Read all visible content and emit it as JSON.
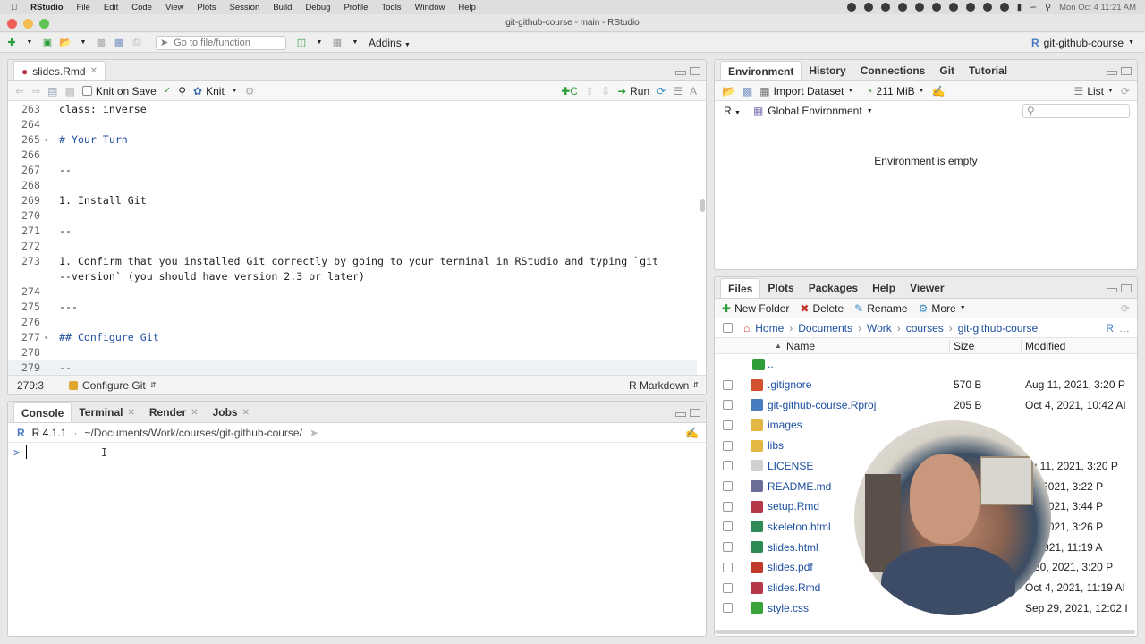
{
  "menubar": {
    "items": [
      "RStudio",
      "File",
      "Edit",
      "Code",
      "View",
      "Plots",
      "Session",
      "Build",
      "Debug",
      "Profile",
      "Tools",
      "Window",
      "Help"
    ],
    "clock": "Mon Oct 4  11:21 AM"
  },
  "window": {
    "title": "git-github-course - main - RStudio"
  },
  "toolbar": {
    "goto_placeholder": "Go to file/function",
    "addins_label": "Addins",
    "project_label": "git-github-course"
  },
  "editor": {
    "tab_label": "slides.Rmd",
    "knit_on_save_label": "Knit on Save",
    "knit_label": "Knit",
    "run_label": "Run",
    "lines": [
      {
        "n": "263",
        "text": "class: inverse",
        "fold": false
      },
      {
        "n": "264",
        "text": "",
        "fold": false
      },
      {
        "n": "265",
        "text": "# Your Turn",
        "fold": true
      },
      {
        "n": "266",
        "text": "",
        "fold": false
      },
      {
        "n": "267",
        "text": "--",
        "fold": false
      },
      {
        "n": "268",
        "text": "",
        "fold": false
      },
      {
        "n": "269",
        "text": "1. Install Git",
        "fold": false
      },
      {
        "n": "270",
        "text": "",
        "fold": false
      },
      {
        "n": "271",
        "text": "--",
        "fold": false
      },
      {
        "n": "272",
        "text": "",
        "fold": false
      },
      {
        "n": "273",
        "text": "1. Confirm that you installed Git correctly by going to your terminal in RStudio and typing `git",
        "cont": "--version` (you should have version 2.3 or later)",
        "fold": false
      },
      {
        "n": "274",
        "text": "",
        "fold": false
      },
      {
        "n": "275",
        "text": "---",
        "fold": false
      },
      {
        "n": "276",
        "text": "",
        "fold": false
      },
      {
        "n": "277",
        "text": "## Configure Git",
        "fold": true
      },
      {
        "n": "278",
        "text": "",
        "fold": false
      },
      {
        "n": "279",
        "text": "--",
        "fold": false
      }
    ],
    "status_position": "279:3",
    "status_section": "Configure Git",
    "status_mode": "R Markdown"
  },
  "console": {
    "tabs": [
      "Console",
      "Terminal",
      "Render",
      "Jobs"
    ],
    "r_version": "R 4.1.1",
    "path": "~/Documents/Work/courses/git-github-course/",
    "prompt": ">"
  },
  "environment": {
    "tabs": [
      "Environment",
      "History",
      "Connections",
      "Git",
      "Tutorial"
    ],
    "import_dataset_label": "Import Dataset",
    "memory_label": "211 MiB",
    "list_label": "List",
    "r_label": "R",
    "scope_label": "Global Environment",
    "empty_message": "Environment is empty"
  },
  "files": {
    "tabs": [
      "Files",
      "Plots",
      "Packages",
      "Help",
      "Viewer"
    ],
    "new_folder_label": "New Folder",
    "delete_label": "Delete",
    "rename_label": "Rename",
    "more_label": "More",
    "breadcrumb": [
      "Home",
      "Documents",
      "Work",
      "courses",
      "git-github-course"
    ],
    "columns": {
      "name": "Name",
      "size": "Size",
      "modified": "Modified"
    },
    "rows": [
      {
        "name": "..",
        "size": "",
        "modified": "",
        "icon": "parent-folder-icon",
        "color": "#2f9e3a"
      },
      {
        "name": ".gitignore",
        "size": "570 B",
        "modified": "Aug 11, 2021, 3:20 P",
        "icon": "git-file-icon",
        "color": "#d2512f"
      },
      {
        "name": "git-github-course.Rproj",
        "size": "205 B",
        "modified": "Oct 4, 2021, 10:42 AI",
        "icon": "rproj-file-icon",
        "color": "#4a7cc0"
      },
      {
        "name": "images",
        "size": "",
        "modified": "",
        "icon": "folder-icon",
        "color": "#e3b743"
      },
      {
        "name": "libs",
        "size": "",
        "modified": "",
        "icon": "folder-icon",
        "color": "#e3b743"
      },
      {
        "name": "LICENSE",
        "size": "",
        "modified": "ug 11, 2021, 3:20 P",
        "icon": "text-file-icon",
        "color": "#cfcfcf"
      },
      {
        "name": "README.md",
        "size": "",
        "modified": "11, 2021, 3:22 P",
        "icon": "markdown-file-icon",
        "color": "#6d6d9a"
      },
      {
        "name": "setup.Rmd",
        "size": "",
        "modified": "11, 2021, 3:44 P",
        "icon": "rmd-file-icon",
        "color": "#b5384a"
      },
      {
        "name": "skeleton.html",
        "size": "",
        "modified": "11, 2021, 3:26 P",
        "icon": "html-file-icon",
        "color": "#2e8b57"
      },
      {
        "name": "slides.html",
        "size": "",
        "modified": "4, 2021, 11:19 A",
        "icon": "html-file-icon",
        "color": "#2e8b57"
      },
      {
        "name": "slides.pdf",
        "size": "",
        "modified": "p 30, 2021, 3:20 P",
        "icon": "pdf-file-icon",
        "color": "#c0392b"
      },
      {
        "name": "slides.Rmd",
        "size": "",
        "modified": "Oct 4, 2021, 11:19 AI",
        "icon": "rmd-file-icon",
        "color": "#b5384a"
      },
      {
        "name": "style.css",
        "size": "",
        "modified": "Sep 29, 2021, 12:02 I",
        "icon": "css-file-icon",
        "color": "#3aa53a"
      }
    ]
  }
}
